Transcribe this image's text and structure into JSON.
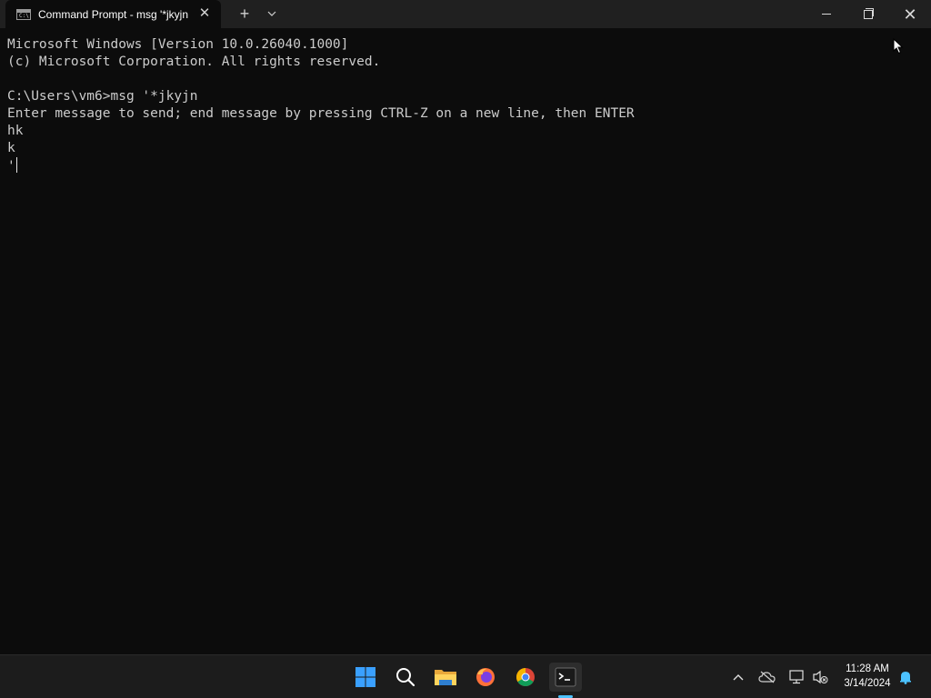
{
  "window": {
    "tab_title": "Command Prompt - msg  '*jkyjn",
    "tab_icon_text": "C:\\",
    "new_tab_label": "+",
    "dropdown_label": "⌄",
    "close_tab_label": "✕",
    "close_window_label": "✕"
  },
  "terminal": {
    "lines": [
      "Microsoft Windows [Version 10.0.26040.1000]",
      "(c) Microsoft Corporation. All rights reserved.",
      "",
      "C:\\Users\\vm6>msg '*jkyjn",
      "Enter message to send; end message by pressing CTRL-Z on a new line, then ENTER",
      "hk",
      "k",
      "'"
    ]
  },
  "taskbar": {
    "apps": [
      "start-icon",
      "search-icon",
      "file-explorer-icon",
      "firefox-icon",
      "chrome-icon",
      "terminal-icon"
    ],
    "tray_chevron": "^",
    "time": "11:28 AM",
    "date": "3/14/2024"
  },
  "colors": {
    "background": "#0c0c0c",
    "titlebar": "#202020",
    "taskbar": "#1c1c1c",
    "text": "#cccccc",
    "accent": "#4cc2ff"
  }
}
